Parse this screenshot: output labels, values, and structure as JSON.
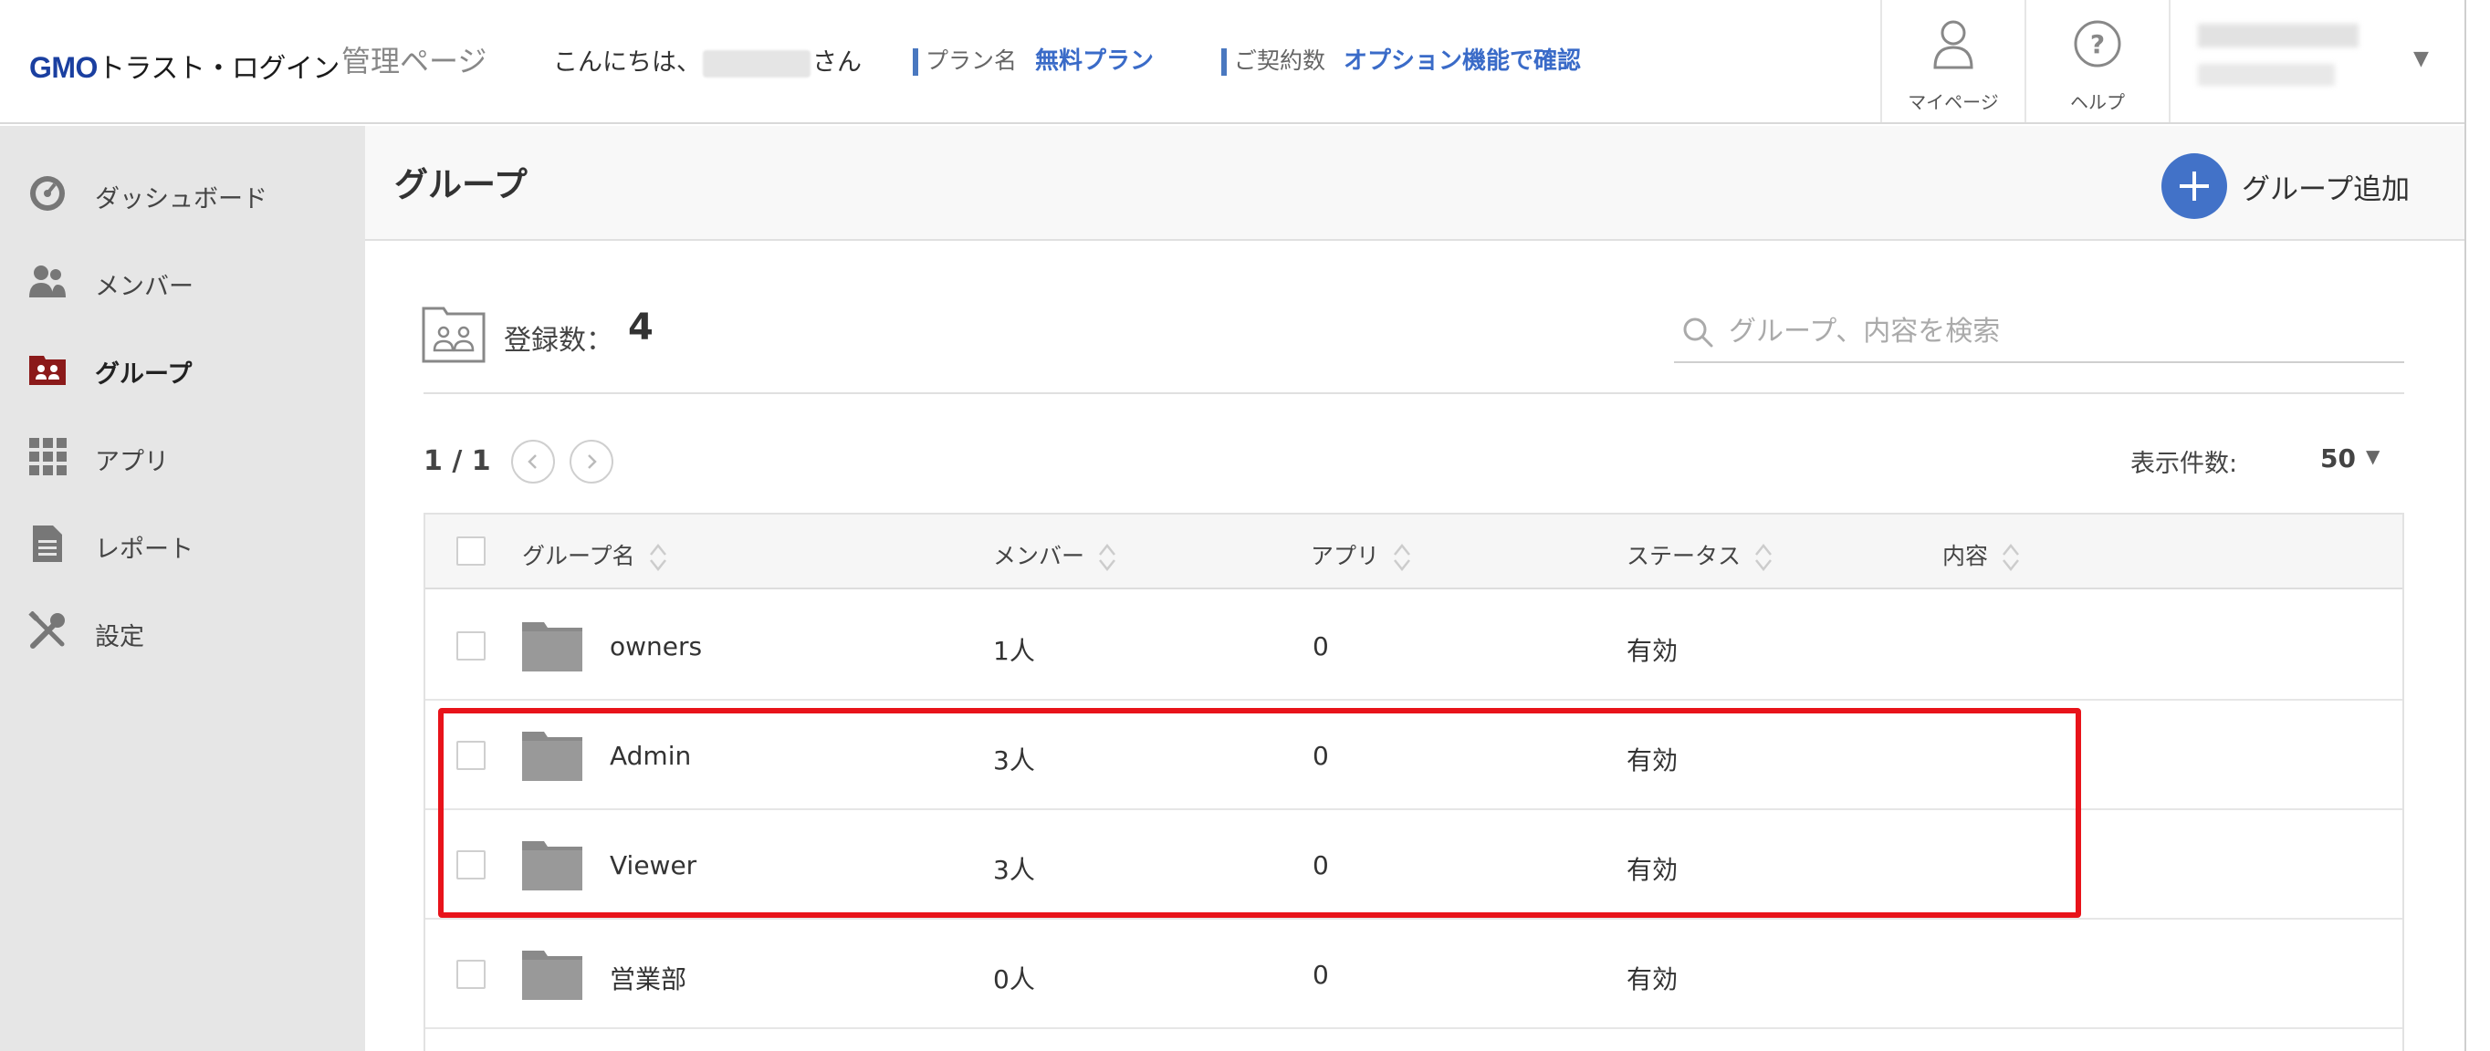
{
  "header": {
    "logo_brand": "GMO",
    "logo_text": "トラスト・ログイン",
    "admin_title": "管理ページ",
    "greeting_prefix": "こんにちは、",
    "greeting_suffix": "さん",
    "plan_label": "プラン名",
    "plan_value": "無料プラン",
    "contract_label": "ご契約数",
    "contract_value": "オプション機能で確認",
    "mypage_label": "マイページ",
    "help_label": "ヘルプ"
  },
  "sidebar": {
    "items": [
      {
        "label": "ダッシュボード",
        "icon": "dashboard-icon"
      },
      {
        "label": "メンバー",
        "icon": "members-icon"
      },
      {
        "label": "グループ",
        "icon": "group-icon",
        "active": true
      },
      {
        "label": "アプリ",
        "icon": "apps-grid-icon"
      },
      {
        "label": "レポート",
        "icon": "report-icon"
      },
      {
        "label": "設定",
        "icon": "settings-tools-icon"
      }
    ]
  },
  "main": {
    "title": "グループ",
    "add_button_label": "グループ追加",
    "count_label": "登録数：",
    "count_value": "4",
    "search_placeholder": "グループ、内容を検索",
    "pager_text": "1 / 1",
    "per_page_label": "表示件数:",
    "per_page_value": "50"
  },
  "table": {
    "columns": [
      "グループ名",
      "メンバー",
      "アプリ",
      "ステータス",
      "内容"
    ],
    "rows": [
      {
        "name": "owners",
        "members": "1人",
        "apps": "0",
        "status": "有効",
        "desc": ""
      },
      {
        "name": "Admin",
        "members": "3人",
        "apps": "0",
        "status": "有効",
        "desc": ""
      },
      {
        "name": "Viewer",
        "members": "3人",
        "apps": "0",
        "status": "有効",
        "desc": ""
      },
      {
        "name": "営業部",
        "members": "0人",
        "apps": "0",
        "status": "有効",
        "desc": ""
      }
    ]
  },
  "colors": {
    "accent_blue": "#4272c8",
    "highlight_red": "#e8131a",
    "sidebar_bg": "#e6e6e6",
    "active_icon": "#8b1a1a"
  }
}
